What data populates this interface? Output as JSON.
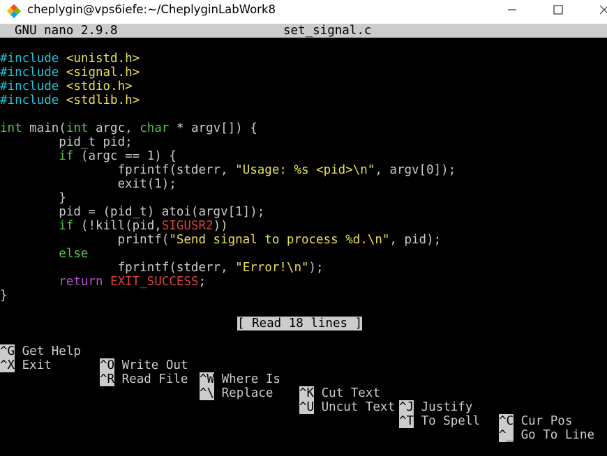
{
  "window": {
    "title": "cheplygin@vps6iefe:~/CheplyginLabWork8",
    "minimize_icon": "minimize-icon",
    "maximize_icon": "maximize-icon",
    "close_icon": "close-icon",
    "app_icon": "git-diamond-icon"
  },
  "nano": {
    "version": "GNU nano 2.9.8",
    "filename": "set_signal.c",
    "status": "[ Read 18 lines ]"
  },
  "code": {
    "l1": [
      "#include",
      " ",
      "<unistd.h>"
    ],
    "l2": [
      "#include",
      " ",
      "<signal.h>"
    ],
    "l3": [
      "#include",
      " ",
      "<stdio.h>"
    ],
    "l4": [
      "#include",
      " ",
      "<stdlib.h>"
    ],
    "l6": [
      "int",
      " main(",
      "int",
      " argc, ",
      "char",
      " * argv[]) {"
    ],
    "l7": [
      "        pid_t pid;"
    ],
    "l8": [
      "        ",
      "if",
      " (argc == 1) {"
    ],
    "l9": [
      "                fprintf(stderr, ",
      "\"Usage: %s <pid>\\n\"",
      ", argv[0]);"
    ],
    "l10": [
      "                exit(1);"
    ],
    "l11": [
      "        }"
    ],
    "l12": [
      "        pid = (pid_t) atoi(argv[1]);"
    ],
    "l13": [
      "        ",
      "if",
      " (!kill(pid,",
      "SIGUSR2",
      "))"
    ],
    "l14": [
      "                printf(",
      "\"Send signal to process %d.\\n\"",
      ", pid);"
    ],
    "l15": [
      "        ",
      "else"
    ],
    "l16": [
      "                fprintf(stderr, ",
      "\"Error!\\n\"",
      ");"
    ],
    "l17": [
      "        ",
      "return",
      " ",
      "EXIT_SUCCESS",
      ";"
    ],
    "l18": [
      "}"
    ]
  },
  "shortcuts_row1": [
    {
      "key": "^G",
      "label": "Get Help"
    },
    {
      "key": "^O",
      "label": "Write Out"
    },
    {
      "key": "^W",
      "label": "Where Is"
    },
    {
      "key": "^K",
      "label": "Cut Text"
    },
    {
      "key": "^J",
      "label": "Justify"
    },
    {
      "key": "^C",
      "label": "Cur Pos"
    }
  ],
  "shortcuts_row2": [
    {
      "key": "^X",
      "label": "Exit"
    },
    {
      "key": "^R",
      "label": "Read File"
    },
    {
      "key": "^\\",
      "label": "Replace"
    },
    {
      "key": "^U",
      "label": "Uncut Text"
    },
    {
      "key": "^T",
      "label": "To Spell"
    },
    {
      "key": "^_",
      "label": "Go To Line"
    }
  ]
}
